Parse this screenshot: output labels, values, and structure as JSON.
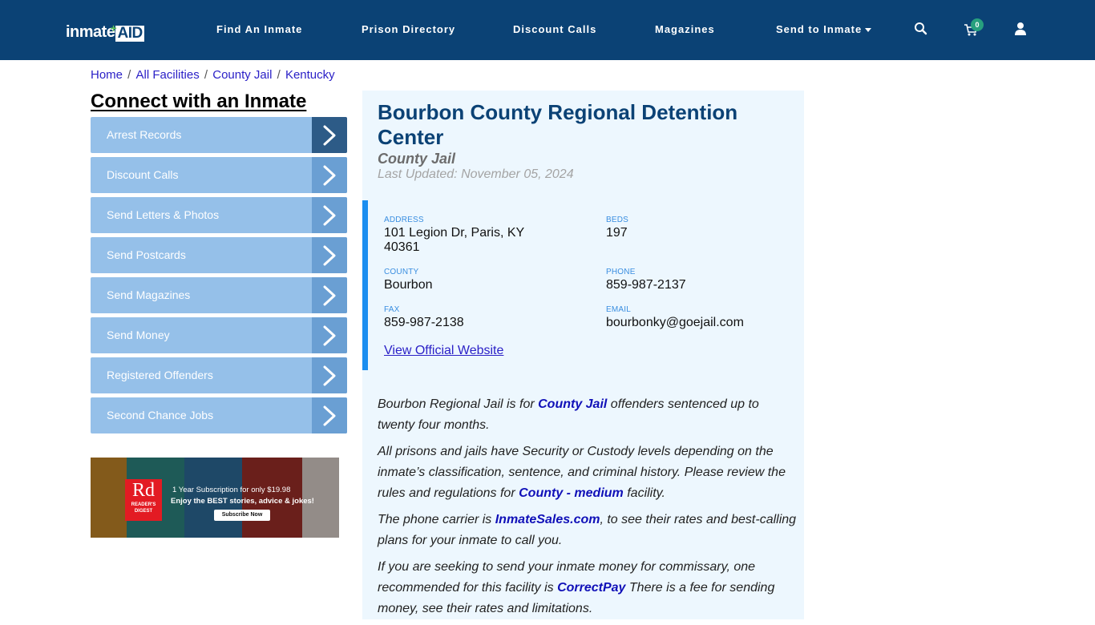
{
  "header": {
    "logo_left": "inmate",
    "logo_right": "AID",
    "nav": [
      {
        "label": "Find An Inmate"
      },
      {
        "label": "Prison Directory"
      },
      {
        "label": "Discount Calls"
      },
      {
        "label": "Magazines"
      },
      {
        "label": "Send to Inmate",
        "has_dropdown": true
      }
    ],
    "cart_count": "0",
    "icons": [
      "search-icon",
      "cart-icon",
      "user-icon"
    ]
  },
  "breadcrumb": [
    {
      "label": "Home"
    },
    {
      "label": "All Facilities"
    },
    {
      "label": "County Jail"
    },
    {
      "label": "Kentucky"
    }
  ],
  "sidebar": {
    "title": "Connect with an Inmate",
    "items": [
      {
        "label": "Arrest Records"
      },
      {
        "label": "Discount Calls"
      },
      {
        "label": "Send Letters & Photos"
      },
      {
        "label": "Send Postcards"
      },
      {
        "label": "Send Magazines"
      },
      {
        "label": "Send Money"
      },
      {
        "label": "Registered Offenders"
      },
      {
        "label": "Second Chance Jobs"
      }
    ],
    "ad": {
      "brand_short": "Rd",
      "brand": "READER'S DIGEST",
      "line1": "1 Year Subscription for only $19.98",
      "line2": "Enjoy the BEST stories, advice & jokes!",
      "cta": "Subscribe Now"
    }
  },
  "facility": {
    "name": "Bourbon County Regional Detention Center",
    "type": "County Jail",
    "last_updated": "Last Updated: November 05, 2024",
    "fields": {
      "address_label": "ADDRESS",
      "address": "101 Legion Dr, Paris, KY 40361",
      "beds_label": "BEDS",
      "beds": "197",
      "county_label": "COUNTY",
      "county": "Bourbon",
      "phone_label": "PHONE",
      "phone": "859-987-2137",
      "fax_label": "FAX",
      "fax": "859-987-2138",
      "email_label": "EMAIL",
      "email": "bourbonky@goejail.com"
    },
    "website_link": "View Official Website",
    "description": {
      "p1_a": "Bourbon Regional Jail is for ",
      "p1_link": "County Jail",
      "p1_b": " offenders sentenced up to twenty four months.",
      "p2_a": "All prisons and jails have Security or Custody levels depending on the inmate’s classification, sentence, and criminal history. Please review the rules and regulations for ",
      "p2_link": "County - medium",
      "p2_b": " facility.",
      "p3_a": "The phone carrier is ",
      "p3_link": "InmateSales.com",
      "p3_b": ", to see their rates and best-calling plans for your inmate to call you.",
      "p4_a": "If you are seeking to send your inmate money for commissary, one recommended for this facility is ",
      "p4_link": "CorrectPay",
      "p4_b": " There is a fee for sending money, see their rates and limitations."
    }
  },
  "colors": {
    "header_bg": "#0b4275",
    "sidebar_item": "#95c0e9",
    "sidebar_arrow": "#6a9fd3",
    "sidebar_arrow_active": "#2d5b87",
    "panel_bg": "#edf7fe",
    "accent_border": "#1b8ef0",
    "link": "#1010b8"
  }
}
